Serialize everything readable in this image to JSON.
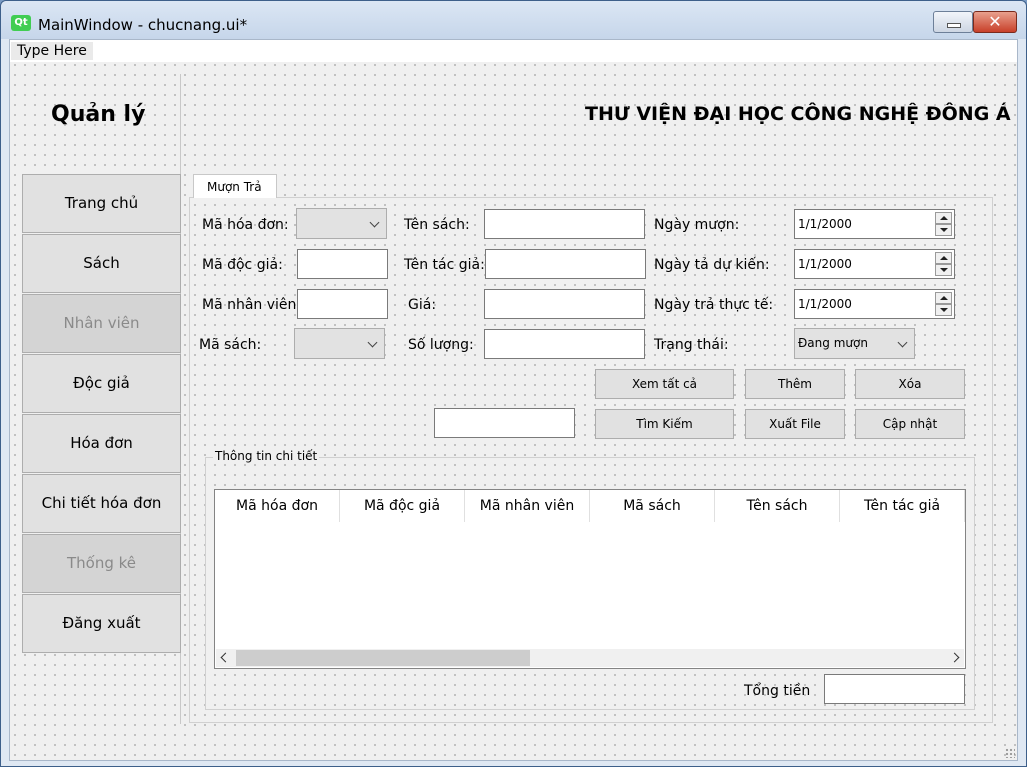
{
  "window": {
    "title": "MainWindow - chucnang.ui*",
    "logo": "Qt",
    "close_symbol": "✕"
  },
  "menubar": {
    "type_here": "Type Here"
  },
  "header": {
    "left_title": "Quản lý",
    "right_title": "THƯ VIỆN ĐẠI HỌC CÔNG NGHỆ ĐÔNG Á"
  },
  "sidebar": {
    "items": [
      {
        "label": "Trang chủ",
        "enabled": true
      },
      {
        "label": "Sách",
        "enabled": true
      },
      {
        "label": "Nhân viên",
        "enabled": false
      },
      {
        "label": "Độc  giả",
        "enabled": true
      },
      {
        "label": "Hóa đơn",
        "enabled": true
      },
      {
        "label": "Chi tiết hóa đơn",
        "enabled": true
      },
      {
        "label": "Thống kê",
        "enabled": false
      },
      {
        "label": "Đăng xuất",
        "enabled": true
      }
    ]
  },
  "tab": {
    "label": "Mượn Trả"
  },
  "form": {
    "ma_hoa_don": "Mã hóa đơn:",
    "ma_doc_gia": "Mã độc giả:",
    "ma_nhan_vien": "Mã nhân viên:",
    "ma_sach": "Mã sách:",
    "ten_sach": "Tên sách:",
    "ten_tac_gia": "Tên tác giả:",
    "gia": "Giá:",
    "so_luong": "Số lượng:",
    "ngay_muon": "Ngày mượn:",
    "ngay_tra_du_kien": "Ngày tả dự kiến:",
    "ngay_tra_thuc_te": "Ngày trả thực tế:",
    "trang_thai": "Trạng thái:",
    "ngay_muon_value": "1/1/2000",
    "ngay_tra_du_kien_value": "1/1/2000",
    "ngay_tra_thuc_te_value": "1/1/2000",
    "trang_thai_value": "Đang mượn"
  },
  "buttons": {
    "xem_tat_ca": "Xem tất cả",
    "them": "Thêm",
    "xoa": "Xóa",
    "tim_kiem": "Tìm Kiếm",
    "xuat_file": "Xuất File",
    "cap_nhat": "Cập nhật"
  },
  "details": {
    "group_title": "Thông tin chi tiết",
    "columns": [
      "Mã hóa đơn",
      "Mã độc giả",
      "Mã nhân viên",
      "Mã sách",
      "Tên sách",
      "Tên tác giả"
    ],
    "total_label": "Tổng tiền"
  }
}
